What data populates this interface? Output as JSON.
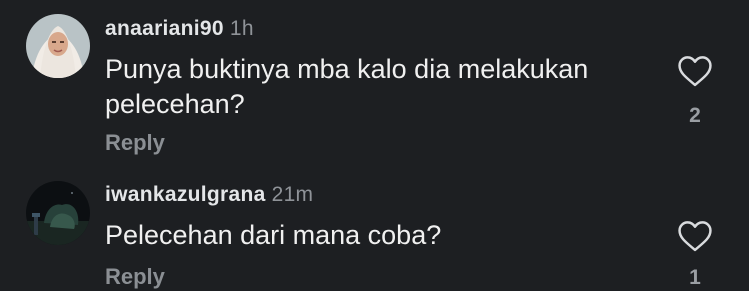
{
  "comments": [
    {
      "username": "anaariani90",
      "time": "1h",
      "text": "Punya buktinya mba kalo dia melakukan pelecehan?",
      "reply_label": "Reply",
      "likes": "2",
      "avatar_icon": "profile-photo-woman-hijab"
    },
    {
      "username": "iwankazulgrana",
      "time": "21m",
      "text": "Pelecehan dari mana coba?",
      "reply_label": "Reply",
      "likes": "1",
      "avatar_icon": "profile-photo-dark-scene"
    }
  ],
  "colors": {
    "background": "#1d1f22",
    "text": "#f0f0f0",
    "muted": "#8b8f94"
  }
}
